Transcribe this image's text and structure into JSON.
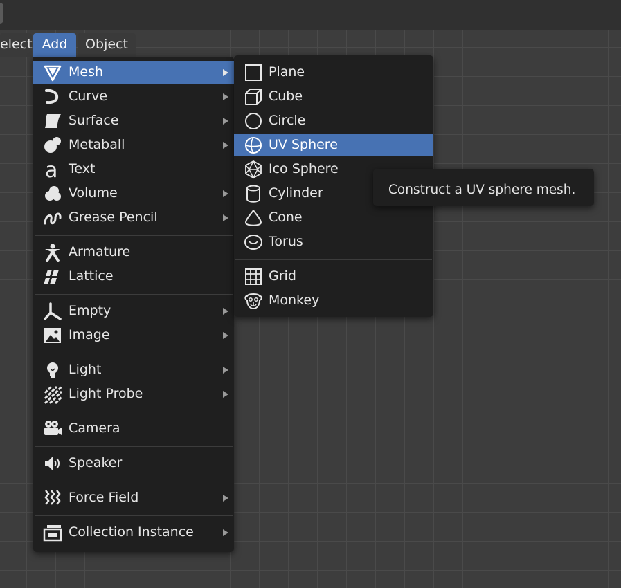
{
  "menubar": {
    "select": "elect",
    "add": "Add",
    "object": "Object"
  },
  "add_menu": {
    "items": [
      {
        "label": "Mesh",
        "icon": "mesh-cone-icon",
        "submenu": true,
        "highlighted": true
      },
      {
        "label": "Curve",
        "icon": "curve-icon",
        "submenu": true
      },
      {
        "label": "Surface",
        "icon": "surface-icon",
        "submenu": true
      },
      {
        "label": "Metaball",
        "icon": "metaball-icon",
        "submenu": true
      },
      {
        "label": "Text",
        "icon": "text-icon",
        "submenu": false
      },
      {
        "label": "Volume",
        "icon": "volume-icon",
        "submenu": true
      },
      {
        "label": "Grease Pencil",
        "icon": "grease-pencil-icon",
        "submenu": true
      },
      {
        "label": "Armature",
        "icon": "armature-icon",
        "submenu": false
      },
      {
        "label": "Lattice",
        "icon": "lattice-icon",
        "submenu": false
      },
      {
        "label": "Empty",
        "icon": "empty-icon",
        "submenu": true
      },
      {
        "label": "Image",
        "icon": "image-icon",
        "submenu": true
      },
      {
        "label": "Light",
        "icon": "light-icon",
        "submenu": true
      },
      {
        "label": "Light Probe",
        "icon": "light-probe-icon",
        "submenu": true
      },
      {
        "label": "Camera",
        "icon": "camera-icon",
        "submenu": false
      },
      {
        "label": "Speaker",
        "icon": "speaker-icon",
        "submenu": false
      },
      {
        "label": "Force Field",
        "icon": "force-field-icon",
        "submenu": true
      },
      {
        "label": "Collection Instance",
        "icon": "collection-instance-icon",
        "submenu": true
      }
    ]
  },
  "mesh_menu": {
    "items": [
      {
        "label": "Plane",
        "icon": "plane-icon"
      },
      {
        "label": "Cube",
        "icon": "cube-icon"
      },
      {
        "label": "Circle",
        "icon": "circle-icon"
      },
      {
        "label": "UV Sphere",
        "icon": "uv-sphere-icon",
        "highlighted": true
      },
      {
        "label": "Ico Sphere",
        "icon": "ico-sphere-icon"
      },
      {
        "label": "Cylinder",
        "icon": "cylinder-icon"
      },
      {
        "label": "Cone",
        "icon": "cone-icon"
      },
      {
        "label": "Torus",
        "icon": "torus-icon"
      },
      {
        "label": "Grid",
        "icon": "grid-icon"
      },
      {
        "label": "Monkey",
        "icon": "monkey-icon"
      }
    ]
  },
  "tooltip": {
    "text": "Construct a UV sphere mesh."
  },
  "colors": {
    "highlight": "#4772b3",
    "menu_bg": "#1f1f1f",
    "viewport_bg": "#3d3d3d"
  }
}
